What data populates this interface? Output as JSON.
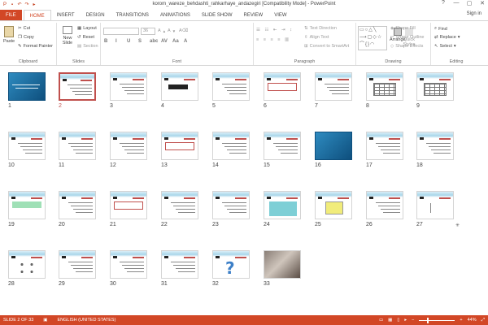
{
  "app": {
    "title": "korom_wareze_behdashti_rahkarhaye_andazegiri [Compatibility Mode] - PowerPoint",
    "sign_in": "Sign in",
    "window_controls": [
      "?",
      "—",
      "▢",
      "✕"
    ]
  },
  "tabs": [
    "FILE",
    "HOME",
    "INSERT",
    "DESIGN",
    "TRANSITIONS",
    "ANIMATIONS",
    "SLIDE SHOW",
    "REVIEW",
    "VIEW"
  ],
  "active_tab": "HOME",
  "ribbon": {
    "clipboard": {
      "label": "Clipboard",
      "paste": "Paste",
      "cut": "Cut",
      "copy": "Copy",
      "format_painter": "Format Painter"
    },
    "slides": {
      "label": "Slides",
      "new_slide": "New Slide",
      "layout": "Layout",
      "reset": "Reset",
      "section": "Section"
    },
    "font": {
      "label": "Font",
      "size": "36",
      "buttons": [
        "B",
        "I",
        "U",
        "S",
        "abc",
        "AV",
        "Aa",
        "A"
      ]
    },
    "paragraph": {
      "label": "Paragraph",
      "text_direction": "Text Direction",
      "align_text": "Align Text",
      "convert_smartart": "Convert to SmartArt"
    },
    "drawing": {
      "label": "Drawing",
      "arrange": "Arrange",
      "quick_styles": "Quick Styles",
      "shape_fill": "Shape Fill",
      "shape_outline": "Shape Outline",
      "shape_effects": "Shape Effects"
    },
    "editing": {
      "label": "Editing",
      "find": "Find",
      "replace": "Replace",
      "select": "Select"
    }
  },
  "slides": [
    {
      "n": "1",
      "kind": "blue-title"
    },
    {
      "n": "2",
      "kind": "text",
      "selected": true
    },
    {
      "n": "3",
      "kind": "text"
    },
    {
      "n": "4",
      "kind": "big-text"
    },
    {
      "n": "5",
      "kind": "text"
    },
    {
      "n": "6",
      "kind": "redbox"
    },
    {
      "n": "7",
      "kind": "text"
    },
    {
      "n": "8",
      "kind": "table"
    },
    {
      "n": "9",
      "kind": "table"
    },
    {
      "n": "10",
      "kind": "text"
    },
    {
      "n": "11",
      "kind": "text"
    },
    {
      "n": "12",
      "kind": "text"
    },
    {
      "n": "13",
      "kind": "redbox"
    },
    {
      "n": "14",
      "kind": "text"
    },
    {
      "n": "15",
      "kind": "text"
    },
    {
      "n": "16",
      "kind": "blue"
    },
    {
      "n": "17",
      "kind": "text"
    },
    {
      "n": "18",
      "kind": "text"
    },
    {
      "n": "19",
      "kind": "greenbox"
    },
    {
      "n": "20",
      "kind": "text"
    },
    {
      "n": "21",
      "kind": "redbox"
    },
    {
      "n": "22",
      "kind": "text"
    },
    {
      "n": "23",
      "kind": "text"
    },
    {
      "n": "24",
      "kind": "cyan"
    },
    {
      "n": "25",
      "kind": "yellow"
    },
    {
      "n": "26",
      "kind": "text"
    },
    {
      "n": "27",
      "kind": "dots",
      "star": true
    },
    {
      "n": "28",
      "kind": "circles"
    },
    {
      "n": "29",
      "kind": "text"
    },
    {
      "n": "30",
      "kind": "text"
    },
    {
      "n": "31",
      "kind": "text"
    },
    {
      "n": "32",
      "kind": "question"
    },
    {
      "n": "33",
      "kind": "photo"
    }
  ],
  "star_mark": "✳",
  "status": {
    "slide": "SLIDE 2 OF 33",
    "language": "ENGLISH (UNITED STATES)",
    "zoom": "44%",
    "zoom_minus": "−",
    "zoom_plus": "+"
  },
  "colors": {
    "accent": "#d24726",
    "selected_border": "#c0504d"
  }
}
